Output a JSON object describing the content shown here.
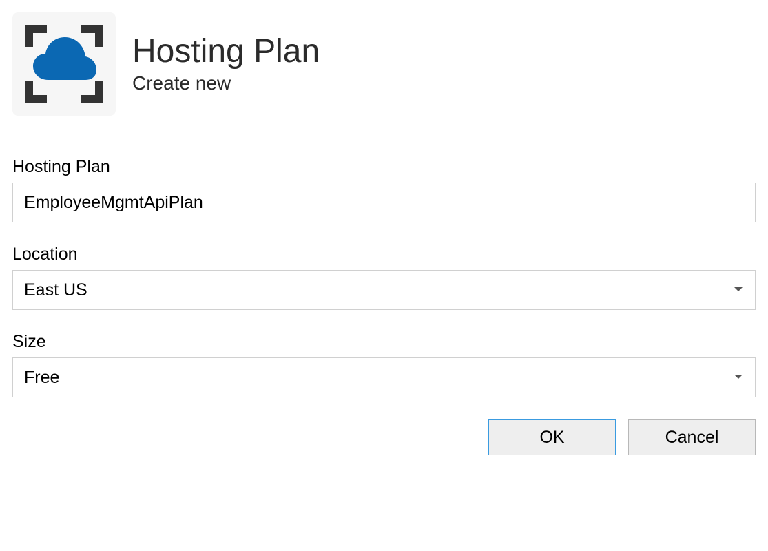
{
  "header": {
    "title": "Hosting Plan",
    "subtitle": "Create new"
  },
  "fields": {
    "hosting_plan": {
      "label": "Hosting Plan",
      "value": "EmployeeMgmtApiPlan"
    },
    "location": {
      "label": "Location",
      "value": "East US"
    },
    "size": {
      "label": "Size",
      "value": "Free"
    }
  },
  "buttons": {
    "ok": "OK",
    "cancel": "Cancel"
  }
}
